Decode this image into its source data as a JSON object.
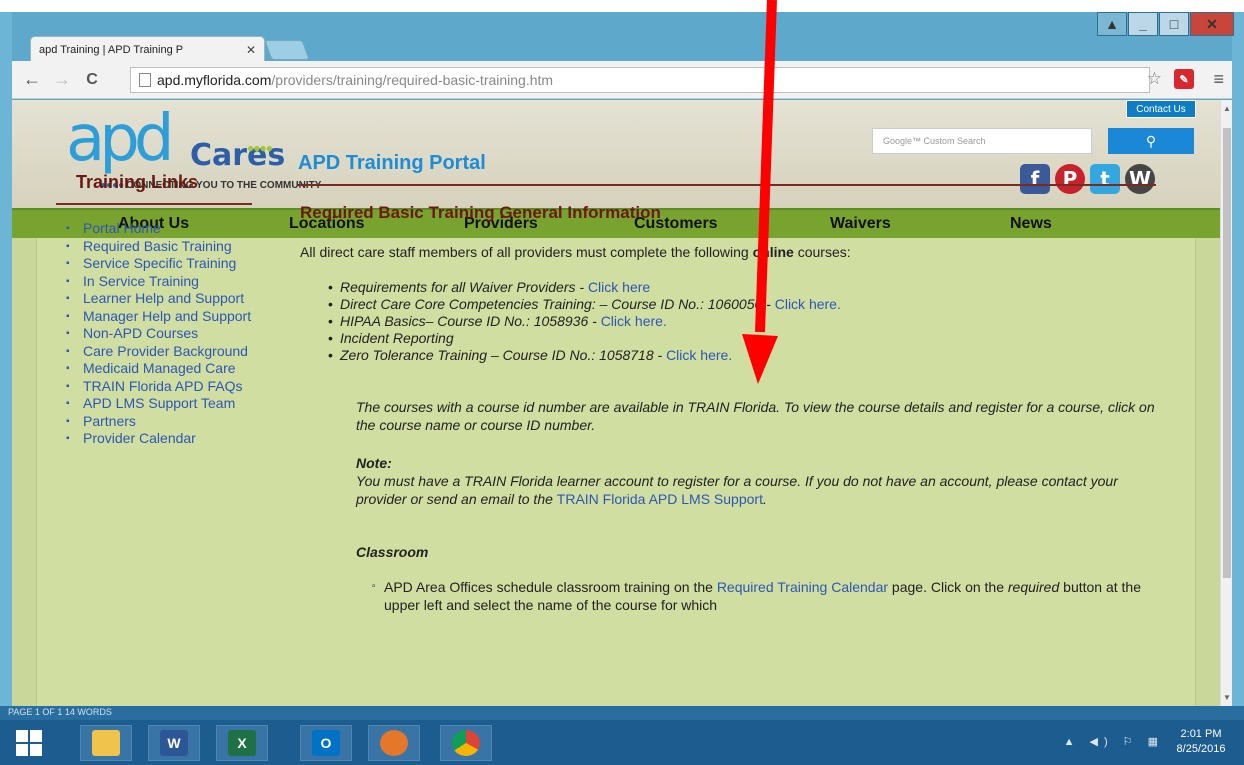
{
  "browser": {
    "tab_title": "apd Training | APD Training P",
    "tab_close": "✕",
    "url_host": "apd.myflorida.com",
    "url_path": "/providers/training/required-basic-training.htm",
    "back_icon": "←",
    "forward_icon": "→",
    "reload_icon": "C",
    "star_icon": "☆",
    "menu_icon": "≡"
  },
  "window": {
    "minimize": "_",
    "maximize": "□",
    "close": "✕"
  },
  "header": {
    "logo_apd": "apd",
    "logo_cares": "Cares",
    "tagline": "CONNECTING YOU TO THE COMMUNITY",
    "contact_label": "Contact Us",
    "search_placeholder": "Google™ Custom Search",
    "search_icon": "🔍",
    "social": {
      "facebook": "f",
      "pinterest": "P",
      "twitter": "t",
      "wordpress": "W"
    }
  },
  "nav": {
    "items": [
      "About Us",
      "Locations",
      "Providers",
      "Customers",
      "Waivers",
      "News"
    ]
  },
  "sidebar": {
    "title": "Training Links",
    "items": [
      "Portal Home",
      "Required Basic Training",
      "Service Specific Training",
      "In Service Training",
      "Learner Help and Support",
      "Manager Help and Support",
      "Non-APD Courses",
      "Care Provider Background",
      "Medicaid Managed Care",
      "TRAIN Florida APD FAQs",
      "APD LMS Support Team",
      "Partners",
      "Provider Calendar"
    ]
  },
  "main": {
    "portal_title": "APD Training Portal",
    "section_heading": "Required Basic Training General Information",
    "intro_before": "All direct care staff members of all providers must complete the following ",
    "intro_bold": "online",
    "intro_after": " courses:",
    "courses": [
      {
        "text": "Requirements for all Waiver Providers - ",
        "link": "Click here"
      },
      {
        "text": "Direct Care Core Competencies Training: – Course ID No.: 1060050 - ",
        "link": "Click here."
      },
      {
        "text": "HIPAA Basics– Course ID No.: 1058936 - ",
        "link": "Click here."
      },
      {
        "text": "Incident Reporting",
        "link": ""
      },
      {
        "text": "Zero Tolerance Training – Course ID No.: 1058718 - ",
        "link": "Click here."
      }
    ],
    "courses_note": "The courses with a course id number are available in TRAIN Florida.  To view the course details and register for a course, click on the course name or course ID number.",
    "note_label": "Note:",
    "note_text": "You must have a TRAIN Florida learner account to register for a course.  If you do not have an account, please contact your provider or send an email to the ",
    "note_link": "TRAIN Florida APD LMS Support",
    "note_end": ".",
    "classroom_label": "Classroom",
    "classroom_text_before": "APD Area Offices schedule classroom training on the ",
    "classroom_link": "Required Training Calendar",
    "classroom_text_after": " page. Click on the ",
    "classroom_required": "required",
    "classroom_text_end": " button at the upper left and select the name of the course for which"
  },
  "taskbar": {
    "status_strip": "PAGE 1 OF 1     14 WORDS",
    "apps": [
      "file-explorer",
      "word",
      "excel",
      "outlook",
      "firefox",
      "chrome"
    ],
    "word_glyph": "W",
    "excel_glyph": "X",
    "outlook_glyph": "O",
    "tray_icons": "▲ ◀) ⚐ ▦",
    "time": "2:01 PM",
    "date": "8/25/2016"
  }
}
